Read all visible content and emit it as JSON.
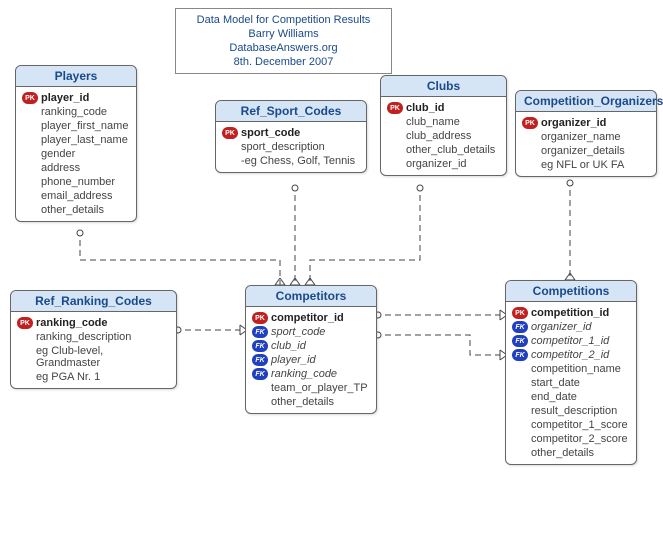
{
  "title": {
    "line1": "Data Model for Competition Results",
    "line2": "Barry Williams",
    "line3": "DatabaseAnswers.org",
    "line4": "8th. December 2007"
  },
  "entities": {
    "players": {
      "name": "Players",
      "attrs": [
        {
          "k": "pk",
          "t": "player_id",
          "b": true
        },
        {
          "k": "",
          "t": "ranking_code"
        },
        {
          "k": "",
          "t": "player_first_name"
        },
        {
          "k": "",
          "t": "player_last_name"
        },
        {
          "k": "",
          "t": "gender"
        },
        {
          "k": "",
          "t": "address"
        },
        {
          "k": "",
          "t": "phone_number"
        },
        {
          "k": "",
          "t": "email_address"
        },
        {
          "k": "",
          "t": "other_details"
        }
      ]
    },
    "ref_sport_codes": {
      "name": "Ref_Sport_Codes",
      "attrs": [
        {
          "k": "pk",
          "t": "sport_code",
          "b": true
        },
        {
          "k": "",
          "t": "sport_description"
        },
        {
          "k": "",
          "t": "-eg Chess, Golf, Tennis"
        }
      ]
    },
    "clubs": {
      "name": "Clubs",
      "attrs": [
        {
          "k": "pk",
          "t": "club_id",
          "b": true
        },
        {
          "k": "",
          "t": "club_name"
        },
        {
          "k": "",
          "t": "club_address"
        },
        {
          "k": "",
          "t": "other_club_details"
        },
        {
          "k": "",
          "t": "organizer_id"
        }
      ]
    },
    "competition_organizers": {
      "name": "Competition_Organizers",
      "attrs": [
        {
          "k": "pk",
          "t": "organizer_id",
          "b": true
        },
        {
          "k": "",
          "t": "organizer_name"
        },
        {
          "k": "",
          "t": "organizer_details"
        },
        {
          "k": "",
          "t": "eg NFL or UK FA"
        }
      ]
    },
    "ref_ranking_codes": {
      "name": "Ref_Ranking_Codes",
      "attrs": [
        {
          "k": "pk",
          "t": "ranking_code",
          "b": true
        },
        {
          "k": "",
          "t": "ranking_description"
        },
        {
          "k": "",
          "t": "eg Club-level, Grandmaster"
        },
        {
          "k": "",
          "t": "eg PGA Nr. 1"
        }
      ]
    },
    "competitors": {
      "name": "Competitors",
      "attrs": [
        {
          "k": "pk",
          "t": "competitor_id",
          "b": true
        },
        {
          "k": "fk",
          "t": "sport_code",
          "i": true
        },
        {
          "k": "fk",
          "t": "club_id",
          "i": true
        },
        {
          "k": "fk",
          "t": "player_id",
          "i": true
        },
        {
          "k": "fk",
          "t": "ranking_code",
          "i": true
        },
        {
          "k": "",
          "t": "team_or_player_TP"
        },
        {
          "k": "",
          "t": "other_details"
        }
      ]
    },
    "competitions": {
      "name": "Competitions",
      "attrs": [
        {
          "k": "pk",
          "t": "competition_id",
          "b": true
        },
        {
          "k": "fk",
          "t": "organizer_id",
          "i": true
        },
        {
          "k": "fk",
          "t": "competitor_1_id",
          "i": true
        },
        {
          "k": "fk",
          "t": "competitor_2_id",
          "i": true
        },
        {
          "k": "",
          "t": "competition_name"
        },
        {
          "k": "",
          "t": "start_date"
        },
        {
          "k": "",
          "t": "end_date"
        },
        {
          "k": "",
          "t": "result_description"
        },
        {
          "k": "",
          "t": "competitor_1_score"
        },
        {
          "k": "",
          "t": "competitor_2_score"
        },
        {
          "k": "",
          "t": "other_details"
        }
      ]
    }
  }
}
